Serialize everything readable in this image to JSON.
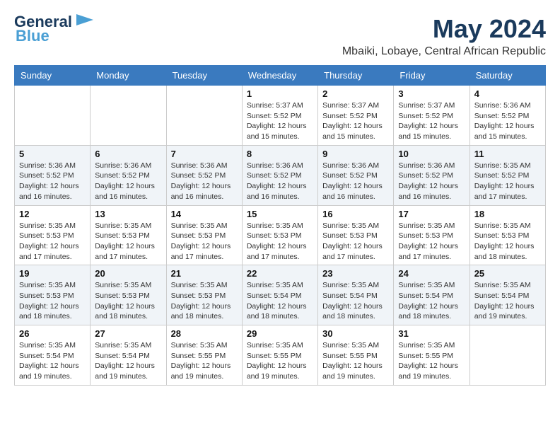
{
  "logo": {
    "line1": "General",
    "line2": "Blue"
  },
  "title": "May 2024",
  "location": "Mbaiki, Lobaye, Central African Republic",
  "days_of_week": [
    "Sunday",
    "Monday",
    "Tuesday",
    "Wednesday",
    "Thursday",
    "Friday",
    "Saturday"
  ],
  "weeks": [
    [
      {
        "day": "",
        "info": ""
      },
      {
        "day": "",
        "info": ""
      },
      {
        "day": "",
        "info": ""
      },
      {
        "day": "1",
        "info": "Sunrise: 5:37 AM\nSunset: 5:52 PM\nDaylight: 12 hours\nand 15 minutes."
      },
      {
        "day": "2",
        "info": "Sunrise: 5:37 AM\nSunset: 5:52 PM\nDaylight: 12 hours\nand 15 minutes."
      },
      {
        "day": "3",
        "info": "Sunrise: 5:37 AM\nSunset: 5:52 PM\nDaylight: 12 hours\nand 15 minutes."
      },
      {
        "day": "4",
        "info": "Sunrise: 5:36 AM\nSunset: 5:52 PM\nDaylight: 12 hours\nand 15 minutes."
      }
    ],
    [
      {
        "day": "5",
        "info": "Sunrise: 5:36 AM\nSunset: 5:52 PM\nDaylight: 12 hours\nand 16 minutes."
      },
      {
        "day": "6",
        "info": "Sunrise: 5:36 AM\nSunset: 5:52 PM\nDaylight: 12 hours\nand 16 minutes."
      },
      {
        "day": "7",
        "info": "Sunrise: 5:36 AM\nSunset: 5:52 PM\nDaylight: 12 hours\nand 16 minutes."
      },
      {
        "day": "8",
        "info": "Sunrise: 5:36 AM\nSunset: 5:52 PM\nDaylight: 12 hours\nand 16 minutes."
      },
      {
        "day": "9",
        "info": "Sunrise: 5:36 AM\nSunset: 5:52 PM\nDaylight: 12 hours\nand 16 minutes."
      },
      {
        "day": "10",
        "info": "Sunrise: 5:36 AM\nSunset: 5:52 PM\nDaylight: 12 hours\nand 16 minutes."
      },
      {
        "day": "11",
        "info": "Sunrise: 5:35 AM\nSunset: 5:52 PM\nDaylight: 12 hours\nand 17 minutes."
      }
    ],
    [
      {
        "day": "12",
        "info": "Sunrise: 5:35 AM\nSunset: 5:53 PM\nDaylight: 12 hours\nand 17 minutes."
      },
      {
        "day": "13",
        "info": "Sunrise: 5:35 AM\nSunset: 5:53 PM\nDaylight: 12 hours\nand 17 minutes."
      },
      {
        "day": "14",
        "info": "Sunrise: 5:35 AM\nSunset: 5:53 PM\nDaylight: 12 hours\nand 17 minutes."
      },
      {
        "day": "15",
        "info": "Sunrise: 5:35 AM\nSunset: 5:53 PM\nDaylight: 12 hours\nand 17 minutes."
      },
      {
        "day": "16",
        "info": "Sunrise: 5:35 AM\nSunset: 5:53 PM\nDaylight: 12 hours\nand 17 minutes."
      },
      {
        "day": "17",
        "info": "Sunrise: 5:35 AM\nSunset: 5:53 PM\nDaylight: 12 hours\nand 17 minutes."
      },
      {
        "day": "18",
        "info": "Sunrise: 5:35 AM\nSunset: 5:53 PM\nDaylight: 12 hours\nand 18 minutes."
      }
    ],
    [
      {
        "day": "19",
        "info": "Sunrise: 5:35 AM\nSunset: 5:53 PM\nDaylight: 12 hours\nand 18 minutes."
      },
      {
        "day": "20",
        "info": "Sunrise: 5:35 AM\nSunset: 5:53 PM\nDaylight: 12 hours\nand 18 minutes."
      },
      {
        "day": "21",
        "info": "Sunrise: 5:35 AM\nSunset: 5:53 PM\nDaylight: 12 hours\nand 18 minutes."
      },
      {
        "day": "22",
        "info": "Sunrise: 5:35 AM\nSunset: 5:54 PM\nDaylight: 12 hours\nand 18 minutes."
      },
      {
        "day": "23",
        "info": "Sunrise: 5:35 AM\nSunset: 5:54 PM\nDaylight: 12 hours\nand 18 minutes."
      },
      {
        "day": "24",
        "info": "Sunrise: 5:35 AM\nSunset: 5:54 PM\nDaylight: 12 hours\nand 18 minutes."
      },
      {
        "day": "25",
        "info": "Sunrise: 5:35 AM\nSunset: 5:54 PM\nDaylight: 12 hours\nand 19 minutes."
      }
    ],
    [
      {
        "day": "26",
        "info": "Sunrise: 5:35 AM\nSunset: 5:54 PM\nDaylight: 12 hours\nand 19 minutes."
      },
      {
        "day": "27",
        "info": "Sunrise: 5:35 AM\nSunset: 5:54 PM\nDaylight: 12 hours\nand 19 minutes."
      },
      {
        "day": "28",
        "info": "Sunrise: 5:35 AM\nSunset: 5:55 PM\nDaylight: 12 hours\nand 19 minutes."
      },
      {
        "day": "29",
        "info": "Sunrise: 5:35 AM\nSunset: 5:55 PM\nDaylight: 12 hours\nand 19 minutes."
      },
      {
        "day": "30",
        "info": "Sunrise: 5:35 AM\nSunset: 5:55 PM\nDaylight: 12 hours\nand 19 minutes."
      },
      {
        "day": "31",
        "info": "Sunrise: 5:35 AM\nSunset: 5:55 PM\nDaylight: 12 hours\nand 19 minutes."
      },
      {
        "day": "",
        "info": ""
      }
    ]
  ]
}
